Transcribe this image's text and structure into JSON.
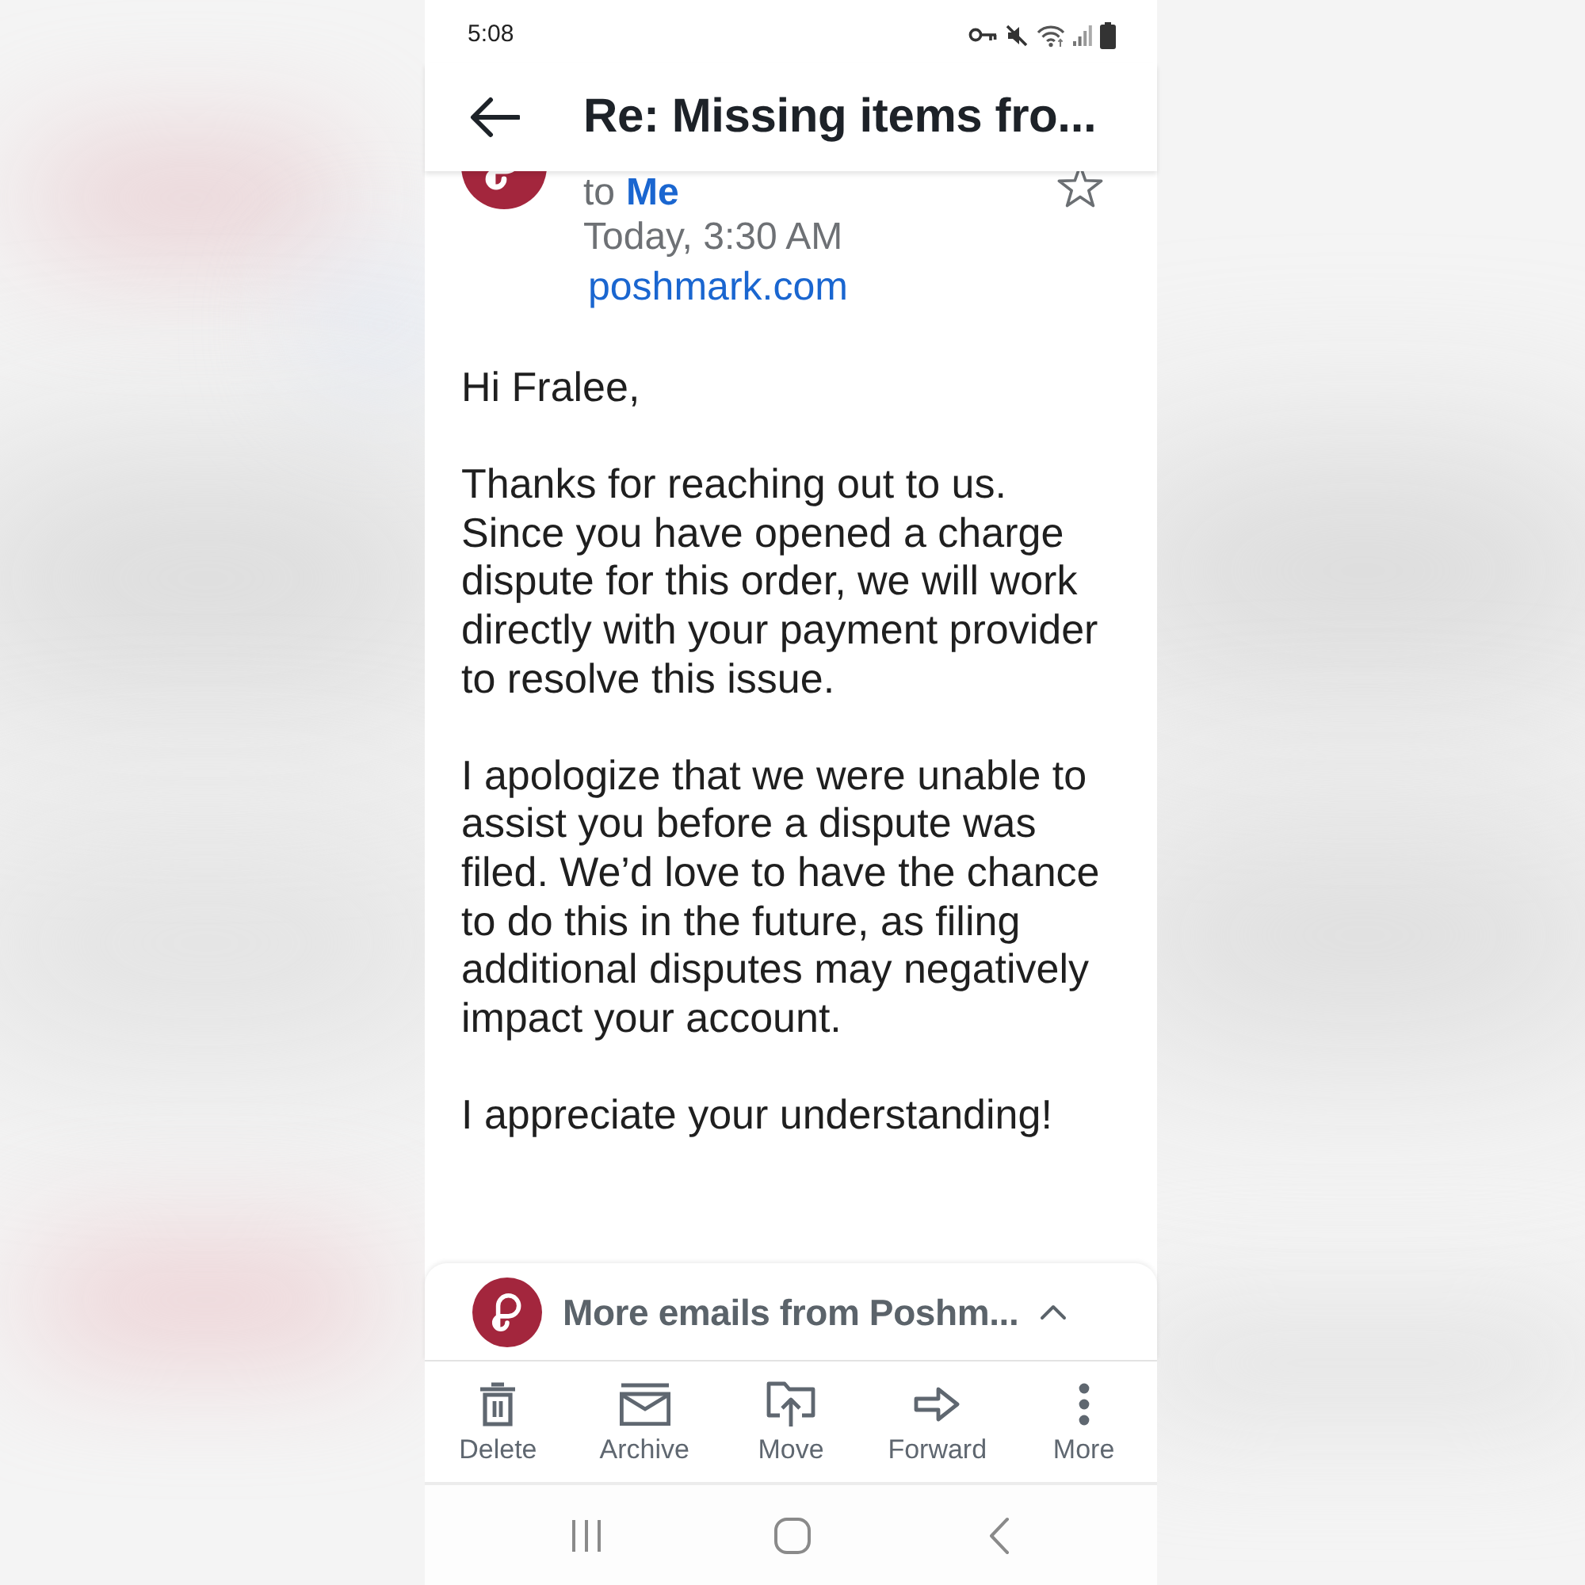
{
  "status_bar": {
    "time": "5:08"
  },
  "header": {
    "title": "Re: Missing items fro..."
  },
  "message": {
    "recipient_prefix": "to",
    "recipient": "Me",
    "starred": false,
    "date": "Today, 3:30 AM",
    "sender_domain": "poshmark.com",
    "body": [
      "Hi Fralee,",
      "Thanks for reaching out to us. Since you have opened a charge dispute for this order, we will work directly with your payment provider to resolve this issue.",
      "I apologize that we were unable to assist you before a dispute was filed. We’d love to have the chance to do this in the future, as filing additional disputes may negatively impact your account.",
      "I appreciate your understanding!"
    ]
  },
  "more_emails": {
    "label": "More emails from Poshm..."
  },
  "toolbar": [
    {
      "label": "Delete"
    },
    {
      "label": "Archive"
    },
    {
      "label": "Move"
    },
    {
      "label": "Forward"
    },
    {
      "label": "More"
    }
  ]
}
